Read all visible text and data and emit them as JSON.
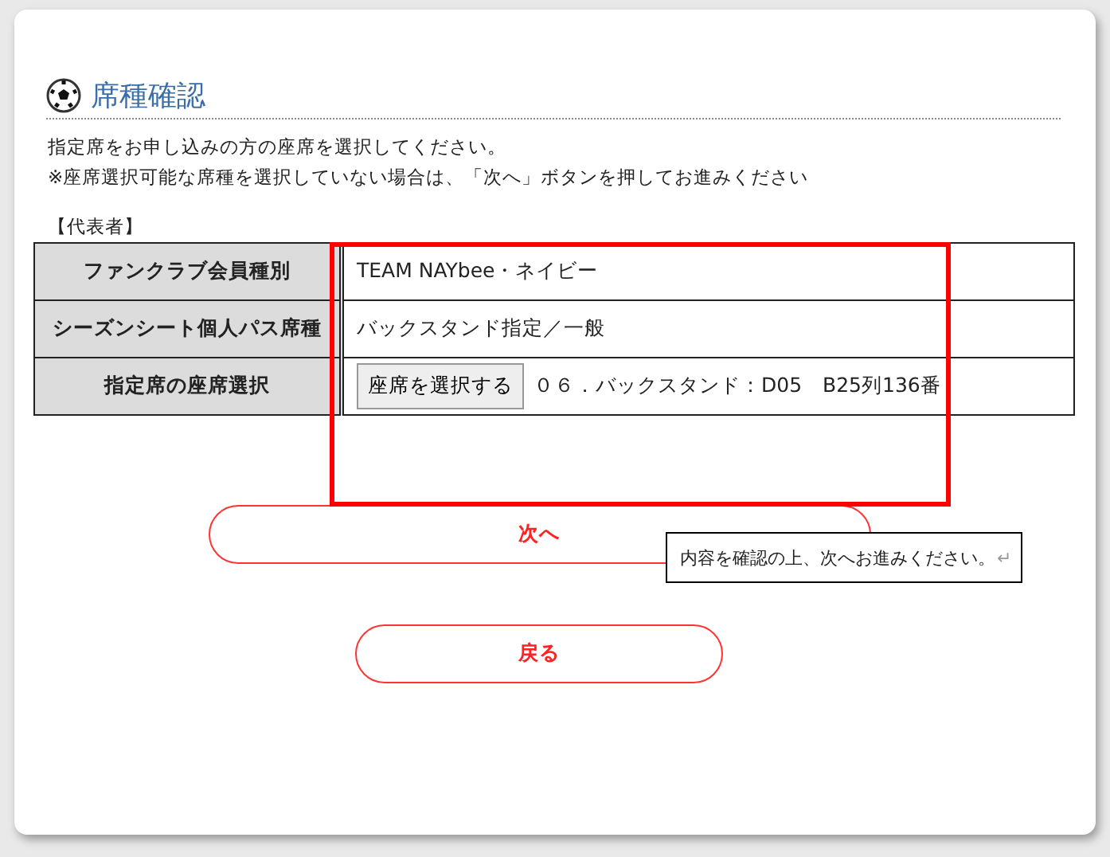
{
  "heading": "席種確認",
  "instructions": [
    "指定席をお申し込みの方の座席を選択してください。",
    "※座席選択可能な席種を選択していない場合は、「次へ」ボタンを押してお進みください"
  ],
  "section_label": "【代表者】",
  "table": {
    "rows": [
      {
        "label": "ファンクラブ会員種別",
        "value": "TEAM NAYbee・ネイビー"
      },
      {
        "label": "シーズンシート個人パス席種",
        "value": "バックスタンド指定／一般"
      },
      {
        "label": "指定席の座席選択",
        "button": "座席を選択する",
        "value": "０６．バックスタンド：D05　B25列136番"
      }
    ]
  },
  "buttons": [
    {
      "label": "次へ"
    },
    {
      "label": "戻る"
    }
  ],
  "callout": {
    "text": "内容を確認の上、次へお進みください。",
    "mark": "↵"
  }
}
